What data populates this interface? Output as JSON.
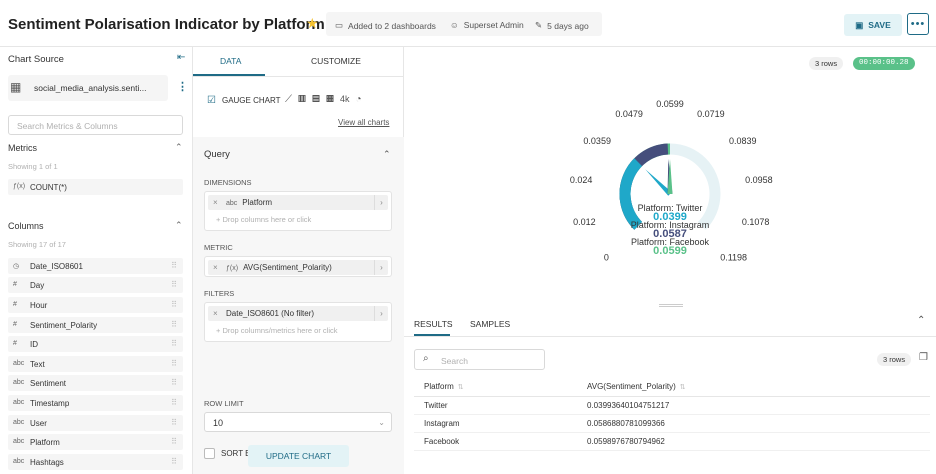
{
  "header": {
    "title": "Sentiment Polarisation Indicator by Platform",
    "dashboards": "Added to 2 dashboards",
    "owner": "Superset Admin",
    "modified": "5 days ago",
    "save_label": "SAVE",
    "more_label": "•••"
  },
  "left_panel": {
    "title": "Chart Source",
    "dataset": "social_media_analysis.senti...",
    "search_placeholder": "Search Metrics & Columns",
    "metrics_header": "Metrics",
    "metrics_showing": "Showing 1 of 1",
    "metrics": [
      {
        "type": "ƒ(x)",
        "name": "COUNT(*)"
      }
    ],
    "columns_header": "Columns",
    "columns_showing": "Showing 17 of 17",
    "columns": [
      {
        "type": "◷",
        "name": "Date_ISO8601"
      },
      {
        "type": "#",
        "name": "Day"
      },
      {
        "type": "#",
        "name": "Hour"
      },
      {
        "type": "#",
        "name": "Sentiment_Polarity"
      },
      {
        "type": "#",
        "name": "ID"
      },
      {
        "type": "abc",
        "name": "Text"
      },
      {
        "type": "abc",
        "name": "Sentiment"
      },
      {
        "type": "abc",
        "name": "Timestamp"
      },
      {
        "type": "abc",
        "name": "User"
      },
      {
        "type": "abc",
        "name": "Platform"
      },
      {
        "type": "abc",
        "name": "Hashtags"
      }
    ]
  },
  "middle_panel": {
    "tab_data": "DATA",
    "tab_customize": "CUSTOMIZE",
    "viz_type": "GAUGE CHART",
    "viz_4k": "4k",
    "view_all": "View all charts",
    "query_header": "Query",
    "dimensions_label": "DIMENSIONS",
    "dimension_value": "Platform",
    "dimension_type": "abc",
    "dimension_drop": "Drop columns here or click",
    "metric_label": "METRIC",
    "metric_value": "AVG(Sentiment_Polarity)",
    "metric_type": "ƒ(x)",
    "filters_label": "FILTERS",
    "filter_value": "Date_ISO8601 (No filter)",
    "filter_drop": "Drop columns/metrics here or click",
    "row_limit_label": "ROW LIMIT",
    "row_limit_value": "10",
    "sort_by_metric": "SORT BY METRIC",
    "update_button": "UPDATE CHART"
  },
  "chart_panel": {
    "rows_badge": "3 rows",
    "time_badge": "00:00:00.28"
  },
  "chart_data": {
    "type": "gauge",
    "min": 0,
    "max": 0.1198,
    "ticks": [
      "0",
      "0.012",
      "0.024",
      "0.0359",
      "0.0479",
      "0.0599",
      "0.0719",
      "0.0839",
      "0.0958",
      "0.1078",
      "0.1198"
    ],
    "series": [
      {
        "name": "Platform: Twitter",
        "value_label": "0.0399",
        "value": 0.03993640104751217,
        "color": "#1fa8c9"
      },
      {
        "name": "Platform: Instagram",
        "value_label": "0.0587",
        "value": 0.0586880781099366,
        "color": "#454e7c"
      },
      {
        "name": "Platform: Facebook",
        "value_label": "0.0599",
        "value": 0.0598976780794962,
        "color": "#5ac189"
      }
    ]
  },
  "results": {
    "tab_results": "RESULTS",
    "tab_samples": "SAMPLES",
    "search_placeholder": "Search",
    "rows_badge": "3 rows",
    "columns": [
      "Platform",
      "AVG(Sentiment_Polarity)"
    ],
    "rows": [
      [
        "Twitter",
        "0.03993640104751217"
      ],
      [
        "Instagram",
        "0.0586880781099366"
      ],
      [
        "Facebook",
        "0.0598976780794962"
      ]
    ]
  }
}
